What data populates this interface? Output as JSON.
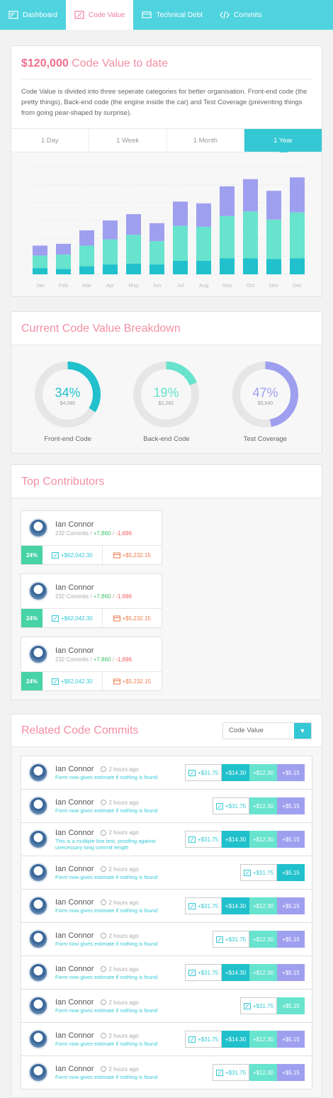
{
  "nav": {
    "items": [
      {
        "label": "Dashboard",
        "icon": "dashboard-icon"
      },
      {
        "label": "Code Value",
        "icon": "code-value-icon"
      },
      {
        "label": "Technical Debt",
        "icon": "technical-debt-icon"
      },
      {
        "label": "Commits",
        "icon": "commits-icon"
      }
    ],
    "active": 1
  },
  "summary": {
    "amount": "$120,000",
    "title_rest": "Code Value to date",
    "description": "Code Value is divided into three seperate categories for better organisation. Front-end code (the pretty things), Back-end code (the engine inside the car) and Test Coverage (preventing things from going pear-shaped by surprise).",
    "tabs": [
      "1 Day",
      "1 Week",
      "1 Month",
      "1 Year"
    ],
    "active_tab": 3
  },
  "chart_data": {
    "type": "bar",
    "stacked": true,
    "categories": [
      "Jan",
      "Feb",
      "Mar",
      "Apr",
      "May",
      "Jun",
      "Jul",
      "Aug",
      "Sep",
      "Oct",
      "Nov",
      "Dec"
    ],
    "series": [
      {
        "color": "#20c1cc",
        "values": [
          7,
          6,
          9,
          11,
          12,
          11,
          15,
          15,
          18,
          18,
          17,
          18
        ]
      },
      {
        "color": "#67e3ce",
        "values": [
          14,
          16,
          23,
          28,
          32,
          26,
          39,
          38,
          47,
          52,
          44,
          51
        ]
      },
      {
        "color": "#9f9ff0",
        "values": [
          11,
          12,
          17,
          21,
          23,
          20,
          27,
          26,
          33,
          36,
          32,
          39
        ]
      }
    ],
    "ylim": [
      0,
      120
    ],
    "grid": true
  },
  "breakdown": {
    "title": "Current Code Value Breakdown",
    "items": [
      {
        "percent": "34%",
        "fraction": 0.34,
        "amount": "$4,080",
        "label": "Front-end Code",
        "color": "#20c1cc"
      },
      {
        "percent": "19%",
        "fraction": 0.19,
        "amount": "$2,282",
        "label": "Back-end Code",
        "color": "#67e3ce"
      },
      {
        "percent": "47%",
        "fraction": 0.47,
        "amount": "$5,640",
        "label": "Test Coverage",
        "color": "#9f9ff0"
      }
    ]
  },
  "contributors": {
    "title": "Top Contributors",
    "items": [
      {
        "name": "Ian Connor",
        "commits": "232 Commits /",
        "plus": "+7,860",
        "slash": "/",
        "minus": "-1,696",
        "pct": "24%",
        "value": "+$62,042.30",
        "debt": "+$5,232.15"
      },
      {
        "name": "Ian Connor",
        "commits": "232 Commits /",
        "plus": "+7,860",
        "slash": "/",
        "minus": "-1,696",
        "pct": "24%",
        "value": "+$62,042.30",
        "debt": "+$5,232.15"
      },
      {
        "name": "Ian Connor",
        "commits": "232 Commits /",
        "plus": "+7,860",
        "slash": "/",
        "minus": "-1,696",
        "pct": "24%",
        "value": "+$62,042.30",
        "debt": "+$5,232.15"
      }
    ]
  },
  "commits": {
    "title": "Related Code Commits",
    "filter": "Code Value",
    "rows": [
      {
        "name": "Ian Connor",
        "ago": "2 hours ago",
        "msg": "Form now gives estimate if nothing is found",
        "val": "+$31.75",
        "teal": "+$14.30",
        "mint": "+$12.30",
        "purp": "+$5.15"
      },
      {
        "name": "Ian Connor",
        "ago": "2 hours ago",
        "msg": "Form now gives estimate if nothing is found",
        "val": "+$31.75",
        "teal": "",
        "mint": "+$12.30",
        "purp": "+$5.15"
      },
      {
        "name": "Ian Connor",
        "ago": "2 hours ago",
        "msg": "This is a multiple line test, proofing against unecessary long commit length",
        "val": "+$31.75",
        "teal": "+$14.30",
        "mint": "+$12.30",
        "purp": "+$5.15"
      },
      {
        "name": "Ian Connor",
        "ago": "2 hours ago",
        "msg": "Form now gives estimate if nothing is found",
        "val": "+$31.75",
        "teal": "+$5.15",
        "mint": "",
        "purp": ""
      },
      {
        "name": "Ian Connor",
        "ago": "2 hours ago",
        "msg": "Form now gives estimate if nothing is found",
        "val": "+$31.75",
        "teal": "+$14.30",
        "mint": "+$12.30",
        "purp": "+$5.15"
      },
      {
        "name": "Ian Connor",
        "ago": "2 hours ago",
        "msg": "Form now gives estimate if nothing is found",
        "val": "+$31.75",
        "teal": "",
        "mint": "+$12.30",
        "purp": "+$5.15"
      },
      {
        "name": "Ian Connor",
        "ago": "2 hours ago",
        "msg": "Form now gives estimate if nothing is found",
        "val": "+$31.75",
        "teal": "+$14.30",
        "mint": "+$12.30",
        "purp": "+$5.15"
      },
      {
        "name": "Ian Connor",
        "ago": "2 hours ago",
        "msg": "Form now gives estimate if nothing is found",
        "val": "+$31.75",
        "teal": "",
        "mint": "+$5.15",
        "purp": ""
      },
      {
        "name": "Ian Connor",
        "ago": "2 hours ago",
        "msg": "Form now gives estimate if nothing is found",
        "val": "+$31.75",
        "teal": "+$14.30",
        "mint": "+$12.30",
        "purp": "+$5.15"
      },
      {
        "name": "Ian Connor",
        "ago": "2 hours ago",
        "msg": "Form now gives estimate if nothing is found",
        "val": "+$31.75",
        "teal": "",
        "mint": "+$12.30",
        "purp": "+$5.15"
      }
    ]
  }
}
